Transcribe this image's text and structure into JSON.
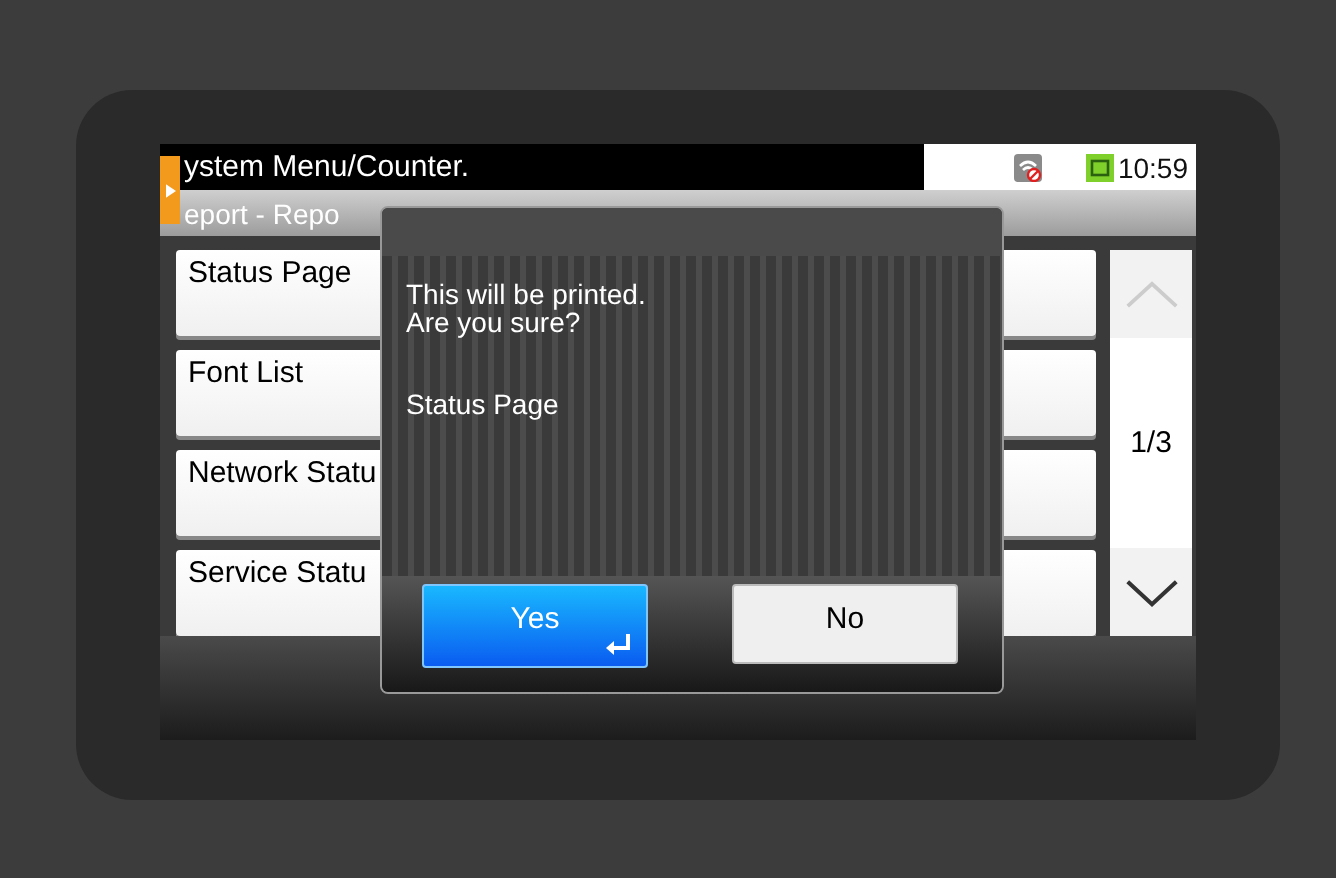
{
  "header": {
    "title": "ystem Menu/Counter.",
    "time": "10:59"
  },
  "breadcrumb": "eport - Repo",
  "items": [
    {
      "label": "Status Page"
    },
    {
      "label": "Font List"
    },
    {
      "label": "Network Statu"
    },
    {
      "label": "Service Statu"
    }
  ],
  "pager": "1/3",
  "dialog": {
    "message": "This will be printed.\nAre you sure?",
    "detail": "Status Page",
    "buttons": [
      {
        "label": "Yes",
        "kind": "primary"
      },
      {
        "label": "No",
        "kind": "secondary"
      }
    ]
  }
}
